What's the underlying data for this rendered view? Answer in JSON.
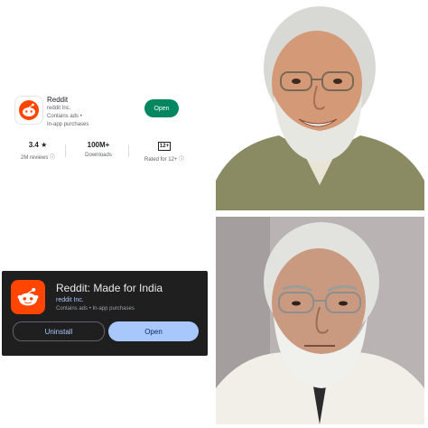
{
  "light_listing": {
    "app_name": "Reddit",
    "developer": "reddit Inc.",
    "contains_ads": "Contains ads  •",
    "in_app_purchases": "In-app purchases",
    "open_label": "Open",
    "rating_value": "3.4 ★",
    "reviews": "2M reviews ⓘ",
    "downloads_value": "100M+",
    "downloads_label": "Downloads",
    "age_badge": "12+",
    "age_label": "Rated for 12+ ⓘ",
    "accent_color": "#01875f"
  },
  "dark_listing": {
    "app_name": "Reddit: Made for India",
    "developer": "reddit Inc.",
    "meta": "Contains ads  •  In-app purchases",
    "uninstall_label": "Uninstall",
    "open_label": "Open",
    "accent_color": "#a8c7fa"
  },
  "icons": {
    "app_icon": "reddit-snoo-icon",
    "brand_color": "#ff4500"
  },
  "photos": {
    "top": "smiling-man-portrait",
    "bottom": "stern-man-portrait"
  }
}
